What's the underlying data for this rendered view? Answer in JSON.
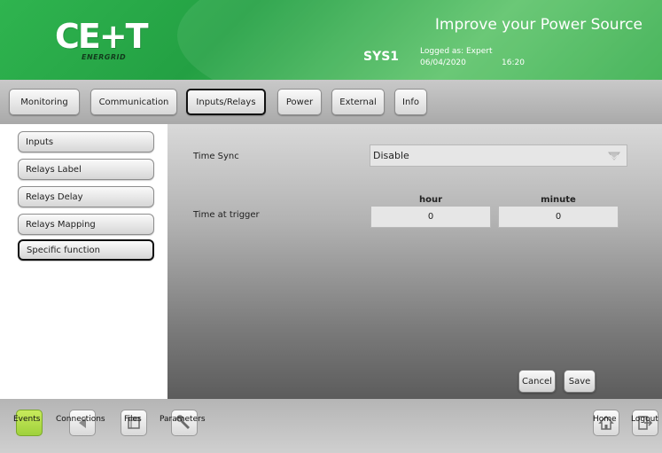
{
  "header": {
    "logo_text": "CE+T",
    "logo_subtext": "ENERGRID",
    "app_title": "Improve your Power Source",
    "system_name": "SYS1",
    "logged_as": "Logged as: Expert",
    "date": "06/04/2020",
    "time": "16:20",
    "brand_color": "#2fb44f"
  },
  "topnav": {
    "tabs": [
      {
        "label": "Monitoring"
      },
      {
        "label": "Communication"
      },
      {
        "label": "Inputs/Relays",
        "active": true
      },
      {
        "label": "Power"
      },
      {
        "label": "External"
      },
      {
        "label": "Info"
      }
    ]
  },
  "sidebar": {
    "items": [
      {
        "label": "Inputs"
      },
      {
        "label": "Relays Label"
      },
      {
        "label": "Relays Delay"
      },
      {
        "label": "Relays Mapping"
      },
      {
        "label": "Specific function",
        "active": true
      }
    ]
  },
  "form": {
    "time_sync_label": "Time Sync",
    "time_sync_value": "Disable",
    "time_at_trigger_label": "Time at trigger",
    "hour_header": "hour",
    "minute_header": "minute",
    "hour_value": "0",
    "minute_value": "0",
    "cancel_label": "Cancel",
    "save_label": "Save"
  },
  "bottombar": {
    "items": [
      {
        "label": "Events",
        "icon": "events-icon",
        "accent": "#a8d645"
      },
      {
        "label": "Connections",
        "icon": "arrow-left-icon"
      },
      {
        "label": "Files",
        "icon": "files-icon"
      },
      {
        "label": "Parameters",
        "icon": "wrench-icon"
      },
      {
        "label": "Home",
        "icon": "home-icon"
      },
      {
        "label": "Logout",
        "icon": "logout-icon"
      }
    ]
  }
}
